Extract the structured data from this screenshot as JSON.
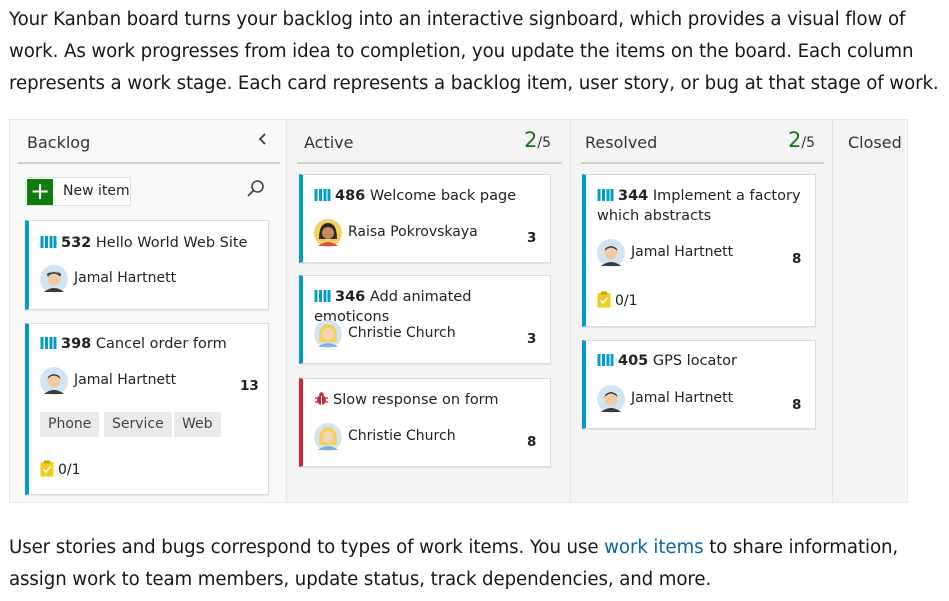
{
  "intro": "Your Kanban board turns your backlog into an interactive signboard, which provides a visual flow of work. As work progresses from idea to completion, you update the items on the board. Each column represents a work stage. Each card represents a backlog item, user story, or bug at that stage of work.",
  "outro": {
    "before": "User stories and bugs correspond to types of work items. You use ",
    "link": "work items",
    "after": " to share information, assign work to team members, update status, track dependencies, and more."
  },
  "colors": {
    "accent_green": "#107c10",
    "story_border": "#009ccc",
    "bug_border": "#cc293d",
    "link": "#0065b3"
  },
  "board": {
    "columns": {
      "backlog": {
        "title": "Backlog",
        "collapse_icon": "chevron-left-icon"
      },
      "active": {
        "title": "Active",
        "wip_count": "2",
        "wip_limit": "/5"
      },
      "resolved": {
        "title": "Resolved",
        "wip_count": "2",
        "wip_limit": "/5"
      },
      "closed": {
        "title": "Closed"
      }
    },
    "new_item": {
      "plus": "+",
      "label": "New item"
    },
    "cards": {
      "c532": {
        "id": "532",
        "title": "Hello World Web Site",
        "assignee": "Jamal Hartnett"
      },
      "c398": {
        "id": "398",
        "title": "Cancel order form",
        "assignee": "Jamal Hartnett",
        "points": "13",
        "tags": [
          "Phone",
          "Service",
          "Web"
        ],
        "tasks": "0/1"
      },
      "c486": {
        "id": "486",
        "title": "Welcome back page",
        "assignee": "Raisa Pokrovskaya",
        "points": "3"
      },
      "c346": {
        "id": "346",
        "title": "Add animated emoticons",
        "assignee": "Christie Church",
        "points": "3"
      },
      "bug1": {
        "title": "Slow response on form",
        "assignee": "Christie Church",
        "points": "8"
      },
      "c344": {
        "id": "344",
        "title_line1": "Implement a factory",
        "title_line2": "which abstracts",
        "assignee": "Jamal Hartnett",
        "points": "8",
        "tasks": "0/1"
      },
      "c405": {
        "id": "405",
        "title": "GPS locator",
        "assignee": "Jamal Hartnett",
        "points": "8"
      }
    }
  }
}
